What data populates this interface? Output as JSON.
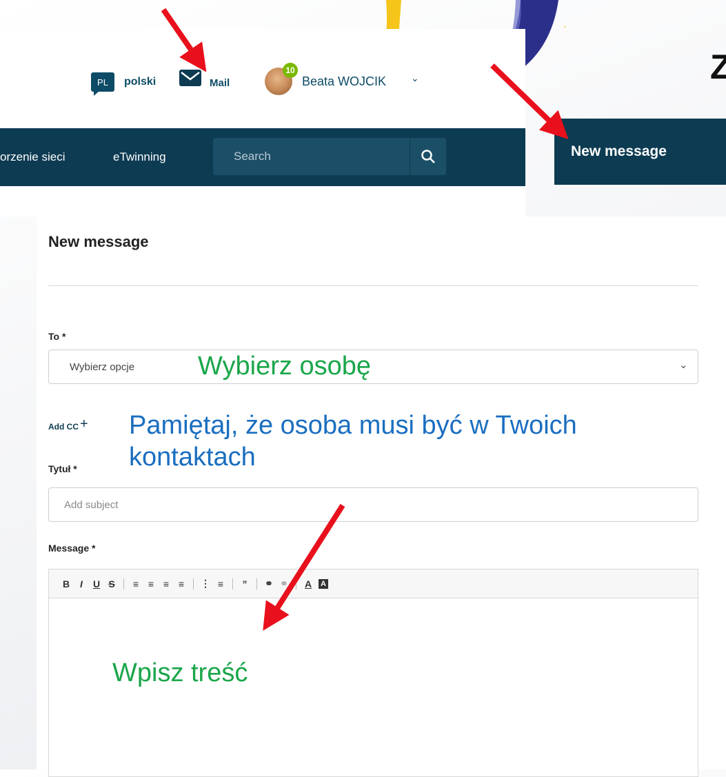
{
  "header": {
    "language_code": "PL",
    "language_label": "polski",
    "mail_label": "Mail",
    "notification_count": "10",
    "user_name": "Beata WOJCIK",
    "nav_items": [
      "orzenie sieci",
      "eTwinning"
    ],
    "search_placeholder": "Search",
    "partial_title_letter": "Z"
  },
  "new_message_button": "New message",
  "form": {
    "title": "New message",
    "to_label": "To *",
    "to_placeholder": "Wybierz opcje",
    "add_cc_label": "Add CC",
    "add_cc_plus": "+",
    "subject_label": "Tytuł *",
    "subject_placeholder": "Add subject",
    "message_label": "Message *",
    "toolbar_buttons": [
      "B",
      "I",
      "U",
      "S",
      "align-left",
      "align-center",
      "align-right",
      "justify",
      "bullet-list",
      "numbered-list",
      "quote",
      "link",
      "unlink",
      "font-color",
      "background-color"
    ]
  },
  "annotations": {
    "choose_person": "Wybierz osobę",
    "contacts_note_line1": "Pamiętaj, że osoba musi być w Twoich",
    "contacts_note_line2": "kontaktach",
    "write_content": "Wpisz treść"
  },
  "colors": {
    "navy": "#0d3b52",
    "annotation_green": "#1aa64a",
    "annotation_blue": "#1a6ec0",
    "arrow_red": "#e8101c"
  }
}
